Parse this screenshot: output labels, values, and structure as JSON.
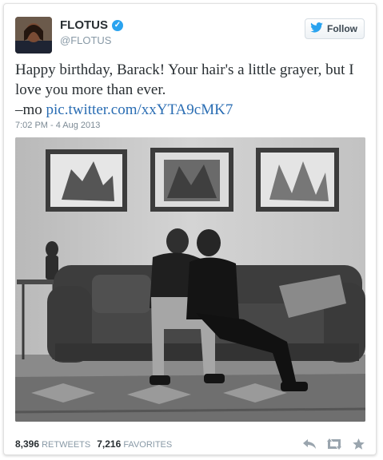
{
  "tweet": {
    "display_name": "FLOTUS",
    "handle": "@FLOTUS",
    "follow_label": "Follow",
    "text_line1": "Happy birthday, Barack! Your hair's a little grayer, but I",
    "text_line2": "love you more than ever.",
    "text_line3_prefix": "–mo ",
    "link_text": "pic.twitter.com/xxYTA9cMK7",
    "timestamp": "7:02 PM - 4 Aug 2013",
    "photo_alt": "Black-and-white photo of a couple sitting on a sofa beneath three framed pictures"
  },
  "stats": {
    "retweets_count": "8,396",
    "retweets_label": "RETWEETS",
    "favorites_count": "7,216",
    "favorites_label": "FAVORITES"
  },
  "icons": {
    "verified": "verified-badge-icon",
    "bird": "twitter-bird-icon",
    "reply": "reply-icon",
    "retweet": "retweet-icon",
    "favorite": "star-icon"
  },
  "colors": {
    "link": "#2a6db3",
    "verified": "#2aa3ef",
    "muted": "#8899a6"
  }
}
